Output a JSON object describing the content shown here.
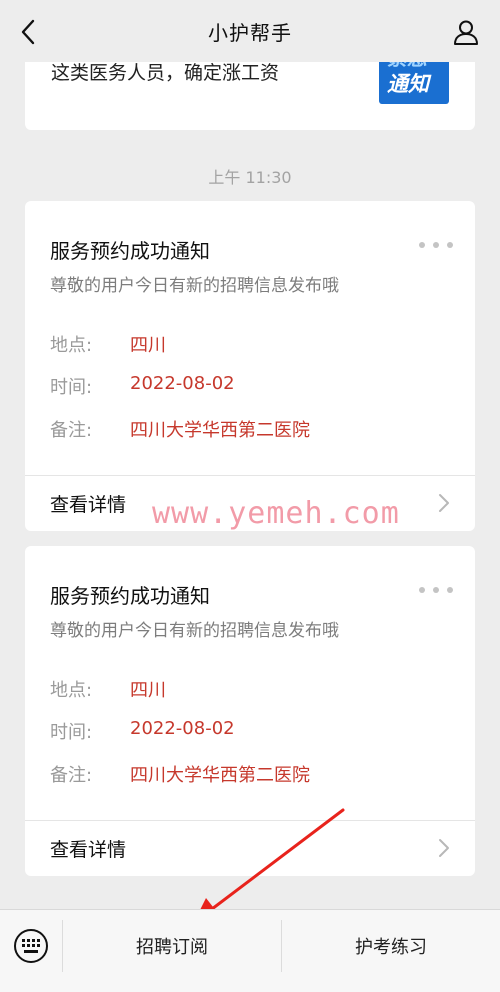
{
  "header": {
    "title": "小护帮手",
    "back_icon": "chevron-left-icon",
    "profile_icon": "user-icon"
  },
  "previous_card": {
    "text": "这类医务人员，确定涨工资",
    "thumb_top_text": "紧急",
    "thumb_main_text": "通知"
  },
  "timestamp": "上午 11:30",
  "cards": [
    {
      "title": "服务预约成功通知",
      "subtitle": "尊敬的用户今日有新的招聘信息发布哦",
      "fields": [
        {
          "label": "地点:",
          "value": "四川"
        },
        {
          "label": "时间:",
          "value": "2022-08-02"
        },
        {
          "label": "备注:",
          "value": "四川大学华西第二医院"
        }
      ],
      "detail_label": "查看详情"
    },
    {
      "title": "服务预约成功通知",
      "subtitle": "尊敬的用户今日有新的招聘信息发布哦",
      "fields": [
        {
          "label": "地点:",
          "value": "四川"
        },
        {
          "label": "时间:",
          "value": "2022-08-02"
        },
        {
          "label": "备注:",
          "value": "四川大学华西第二医院"
        }
      ],
      "detail_label": "查看详情"
    }
  ],
  "watermark": "www.yemeh.com",
  "bottom_bar": {
    "keyboard_icon": "keyboard-icon",
    "tabs": [
      {
        "label": "招聘订阅"
      },
      {
        "label": "护考练习"
      }
    ]
  },
  "colors": {
    "value_red": "#c6382c",
    "background": "#ededed",
    "arrow_red": "#e8231c"
  }
}
